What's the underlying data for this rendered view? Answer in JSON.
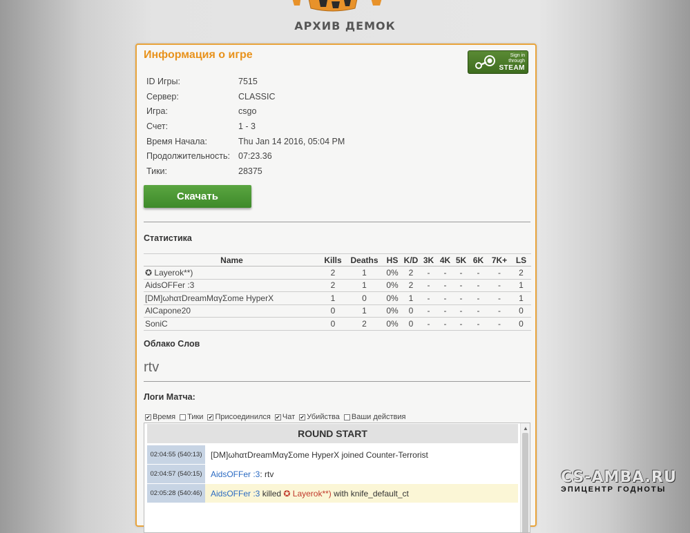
{
  "header": {
    "site_title": "АРХИВ ДЕМОК"
  },
  "game_info": {
    "title": "Информация о игре",
    "steam": {
      "line1": "Sign in through",
      "line2": "STEAM"
    },
    "rows": [
      {
        "label": "ID Игры:",
        "value": "7515"
      },
      {
        "label": "Сервер:",
        "value": "CLASSIC"
      },
      {
        "label": "Игра:",
        "value": "csgo"
      },
      {
        "label": "Счет:",
        "value": "1 - 3"
      },
      {
        "label": "Время Начала:",
        "value": "Thu Jan 14 2016, 05:04 PM"
      },
      {
        "label": "Продолжительность:",
        "value": "07:23.36"
      },
      {
        "label": "Тики:",
        "value": "28375"
      }
    ],
    "download_label": "Скачать"
  },
  "stats": {
    "title": "Статистика",
    "headers": [
      "Name",
      "Kills",
      "Deaths",
      "HS",
      "K/D",
      "3K",
      "4K",
      "5K",
      "6K",
      "7K+",
      "LS"
    ],
    "rows": [
      [
        "✪ Layerok**)",
        "2",
        "1",
        "0%",
        "2",
        "-",
        "-",
        "-",
        "-",
        "-",
        "2"
      ],
      [
        "AidsOFFer :3",
        "2",
        "1",
        "0%",
        "2",
        "-",
        "-",
        "-",
        "-",
        "-",
        "1"
      ],
      [
        "[DM]ωhατDreamMαγΣome HyperX",
        "1",
        "0",
        "0%",
        "1",
        "-",
        "-",
        "-",
        "-",
        "-",
        "1"
      ],
      [
        "AlCapone20",
        "0",
        "1",
        "0%",
        "0",
        "-",
        "-",
        "-",
        "-",
        "-",
        "0"
      ],
      [
        "SoniC",
        "0",
        "2",
        "0%",
        "0",
        "-",
        "-",
        "-",
        "-",
        "-",
        "0"
      ]
    ]
  },
  "word_cloud": {
    "title": "Облако Слов",
    "word": "rtv"
  },
  "match_logs": {
    "title": "Логи Матча:",
    "filters": [
      {
        "label": "Время",
        "checked": true
      },
      {
        "label": "Тики",
        "checked": false
      },
      {
        "label": "Присоединился",
        "checked": true
      },
      {
        "label": "Чат",
        "checked": true
      },
      {
        "label": "Убийства",
        "checked": true
      },
      {
        "label": "Ваши действия",
        "checked": false
      }
    ],
    "round_start": "ROUND START",
    "entries": [
      {
        "time": "02:04:55 (540:13)",
        "player": "[DM]ωhατDreamMαγΣome HyperX",
        "text": " joined Counter-Terrorist"
      },
      {
        "time": "02:04:57 (540:15)",
        "player": "AidsOFFer :3",
        "text": ": rtv"
      },
      {
        "time": "02:05:28 (540:46)",
        "player": "AidsOFFer :3",
        "verb": " killed ",
        "victim": "✪ Layerok**)",
        "text": " with knife_default_ct"
      }
    ]
  },
  "watermark": {
    "line1": "CS-AMBA.RU",
    "line2": "ЭПИЦЕНТР ГОДНОТЫ"
  },
  "colors": {
    "accent": "#e8921c",
    "panel_border": "#e8a33a",
    "download": "#4a9a34",
    "steam": "#4a7b2a",
    "link": "#2a6ac2"
  }
}
